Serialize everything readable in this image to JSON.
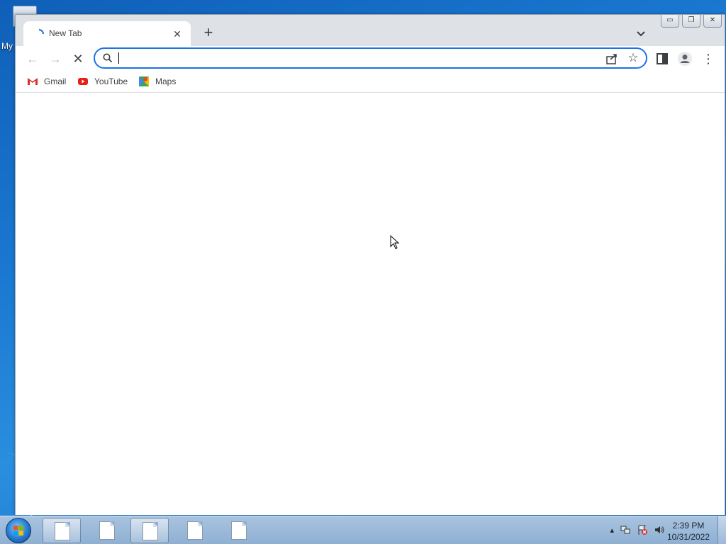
{
  "desktop": {
    "icon_label": "My"
  },
  "browser": {
    "tab": {
      "title": "New Tab",
      "close_glyph": "✕"
    },
    "new_tab_glyph": "+",
    "tab_search_glyph": "⌄",
    "window_controls": {
      "minimize": "▭",
      "restore": "❐",
      "close": "✕"
    },
    "toolbar": {
      "back_glyph": "←",
      "forward_glyph": "→",
      "stop_glyph": "✕",
      "omnibox_value": "",
      "omnibox_placeholder": "",
      "star_glyph": "☆",
      "menu_glyph": "⋮"
    },
    "bookmarks": [
      {
        "label": "Gmail",
        "icon": "gmail-icon"
      },
      {
        "label": "YouTube",
        "icon": "youtube-icon"
      },
      {
        "label": "Maps",
        "icon": "maps-icon"
      }
    ],
    "accent_color": "#1a73e8"
  },
  "taskbar": {
    "clock": {
      "time": "2:39 PM",
      "date": "10/31/2022"
    },
    "tray_expand_glyph": "▴"
  }
}
